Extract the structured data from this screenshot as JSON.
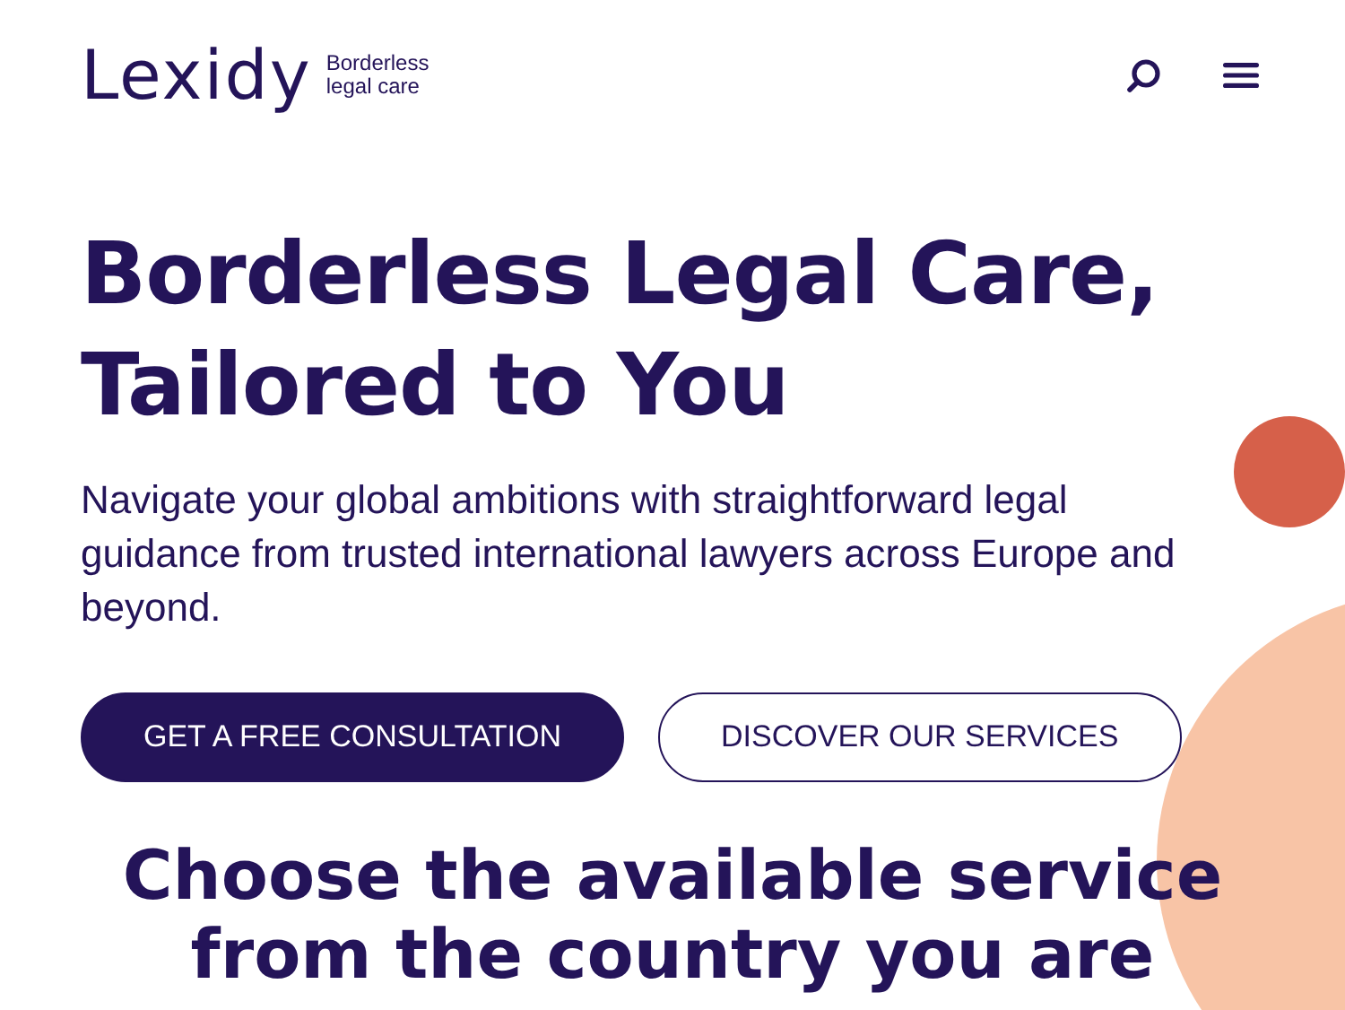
{
  "header": {
    "logo": "Lexidy",
    "tagline_lines": [
      "Borderless",
      "legal care"
    ]
  },
  "hero": {
    "title_lines": [
      "Borderless Legal Care,",
      "Tailored to You"
    ],
    "subtitle": "Navigate your global ambitions with straightforward legal guidance from trusted international lawyers across Europe and beyond.",
    "buttons": [
      {
        "label": "GET A FREE CONSULTATION",
        "kind": "primary"
      },
      {
        "label": "DISCOVER OUR SERVICES",
        "kind": "outline"
      }
    ]
  },
  "services": {
    "title_lines": [
      "Choose the available service",
      "from the country you are"
    ]
  }
}
